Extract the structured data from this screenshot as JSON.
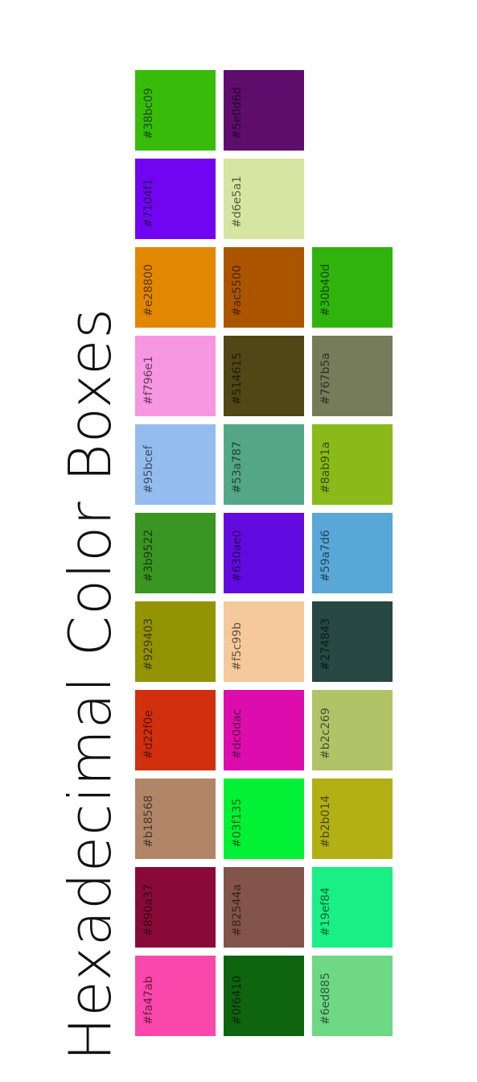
{
  "title": "Hexadecimal Color Boxes",
  "columns": [
    {
      "boxes": [
        {
          "hex": "#38bc09",
          "color": "#38bc09"
        },
        {
          "hex": "#7104f1",
          "color": "#7104f1"
        },
        {
          "hex": "#e28800",
          "color": "#e28800"
        },
        {
          "hex": "#f796e1",
          "color": "#f796e1"
        },
        {
          "hex": "#95bcef",
          "color": "#95bcef"
        },
        {
          "hex": "#3b9522",
          "color": "#3b9522"
        },
        {
          "hex": "#929403",
          "color": "#929403"
        },
        {
          "hex": "#d22f0e",
          "color": "#d22f0e"
        },
        {
          "hex": "#b18568",
          "color": "#b18568"
        },
        {
          "hex": "#890a37",
          "color": "#890a37"
        },
        {
          "hex": "#fa47ab",
          "color": "#fa47ab"
        }
      ]
    },
    {
      "boxes": [
        {
          "hex": "#5e0d6d",
          "color": "#5e0d6d"
        },
        {
          "hex": "#d6e5a1",
          "color": "#d6e5a1"
        },
        {
          "hex": "#ac5500",
          "color": "#ac5500"
        },
        {
          "hex": "#514615",
          "color": "#514615"
        },
        {
          "hex": "#53a787",
          "color": "#53a787"
        },
        {
          "hex": "#630ae0",
          "color": "#630ae0"
        },
        {
          "hex": "#f5c99b",
          "color": "#f5c99b"
        },
        {
          "hex": "#dc0dac",
          "color": "#dc0dac"
        },
        {
          "hex": "#03f135",
          "color": "#03f135"
        },
        {
          "hex": "#82544a",
          "color": "#82544a"
        },
        {
          "hex": "#0f6410",
          "color": "#0f6410"
        }
      ]
    },
    {
      "boxes": [
        {
          "hex": "#30b40d",
          "color": "#30b40d"
        },
        {
          "hex": "#767b5a",
          "color": "#767b5a"
        },
        {
          "hex": "#8ab91a",
          "color": "#8ab91a"
        },
        {
          "hex": "#59a7d6",
          "color": "#59a7d6"
        },
        {
          "hex": "#274843",
          "color": "#274843"
        },
        {
          "hex": "#b2c269",
          "color": "#b2c269"
        },
        {
          "hex": "#b2b014",
          "color": "#b2b014"
        },
        {
          "hex": "#19ef84",
          "color": "#19ef84"
        },
        {
          "hex": "#6ed885",
          "color": "#6ed885"
        }
      ]
    }
  ]
}
